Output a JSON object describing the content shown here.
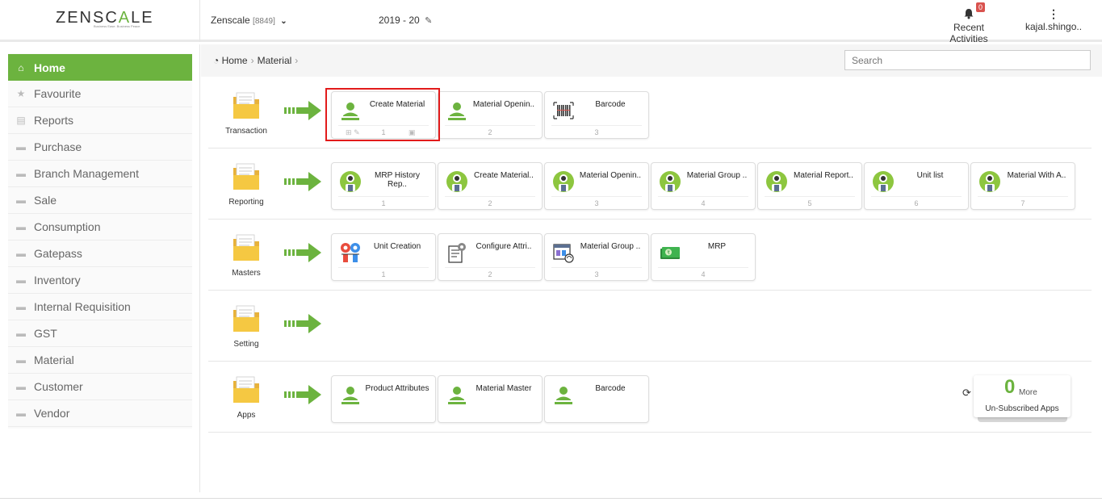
{
  "brand": {
    "logo_text_a": "ZENSC",
    "logo_text_b": "A",
    "logo_text_c": "LE",
    "tagline": "Business Ease. Business Peace."
  },
  "header": {
    "company": "Zenscale",
    "company_code": "[8849]",
    "fiscal_year": "2019 - 20",
    "activities_label": "Recent Activities",
    "activities_count": "0",
    "user_name": "kajal.shingo.."
  },
  "sidebar": {
    "items": [
      {
        "label": "Home",
        "icon": "home-icon"
      },
      {
        "label": "Favourite",
        "icon": "star-icon"
      },
      {
        "label": "Reports",
        "icon": "file-icon"
      },
      {
        "label": "Purchase",
        "icon": "folder-icon"
      },
      {
        "label": "Branch Management",
        "icon": "folder-icon"
      },
      {
        "label": "Sale",
        "icon": "folder-icon"
      },
      {
        "label": "Consumption",
        "icon": "folder-icon"
      },
      {
        "label": "Gatepass",
        "icon": "folder-icon"
      },
      {
        "label": "Inventory",
        "icon": "folder-icon"
      },
      {
        "label": "Internal Requisition",
        "icon": "folder-icon"
      },
      {
        "label": "GST",
        "icon": "folder-icon"
      },
      {
        "label": "Material",
        "icon": "folder-icon"
      },
      {
        "label": "Customer",
        "icon": "folder-icon"
      },
      {
        "label": "Vendor",
        "icon": "folder-icon"
      }
    ]
  },
  "breadcrumb": {
    "home": "Home",
    "current": "Material"
  },
  "search": {
    "placeholder": "Search"
  },
  "categories": [
    {
      "label": "Transaction",
      "cards": [
        {
          "title": "Create Material",
          "num": "1",
          "icon": "user-icon"
        },
        {
          "title": "Material Openin..",
          "num": "2",
          "icon": "user-icon"
        },
        {
          "title": "Barcode",
          "num": "3",
          "icon": "barcode-icon"
        }
      ]
    },
    {
      "label": "Reporting",
      "cards": [
        {
          "title": "MRP History Rep..",
          "num": "1",
          "icon": "report-avatar-icon"
        },
        {
          "title": "Create Material..",
          "num": "2",
          "icon": "report-avatar-icon"
        },
        {
          "title": "Material Openin..",
          "num": "3",
          "icon": "report-avatar-icon"
        },
        {
          "title": "Material Group ..",
          "num": "4",
          "icon": "report-avatar-icon"
        },
        {
          "title": "Material Report..",
          "num": "5",
          "icon": "report-avatar-icon"
        },
        {
          "title": "Unit list",
          "num": "6",
          "icon": "report-avatar-icon"
        },
        {
          "title": "Material With A..",
          "num": "7",
          "icon": "report-avatar-icon"
        }
      ]
    },
    {
      "label": "Masters",
      "cards": [
        {
          "title": "Unit Creation",
          "num": "1",
          "icon": "unit-people-icon"
        },
        {
          "title": "Configure Attri..",
          "num": "2",
          "icon": "config-document-icon"
        },
        {
          "title": "Material Group ..",
          "num": "3",
          "icon": "material-group-icon"
        },
        {
          "title": "MRP",
          "num": "4",
          "icon": "money-icon"
        }
      ]
    },
    {
      "label": "Setting",
      "cards": []
    },
    {
      "label": "Apps",
      "cards": [
        {
          "title": "Product Attributes",
          "num": "",
          "icon": "user-icon"
        },
        {
          "title": "Material Master",
          "num": "",
          "icon": "user-icon"
        },
        {
          "title": "Barcode",
          "num": "",
          "icon": "user-icon"
        }
      ]
    }
  ],
  "more_apps": {
    "count": "0",
    "more_label": "More",
    "sub_label": "Un-Subscribed Apps"
  },
  "colors": {
    "brand_green": "#6cb33f",
    "highlight_red": "#e21b1b",
    "folder_yellow": "#f5c842"
  }
}
